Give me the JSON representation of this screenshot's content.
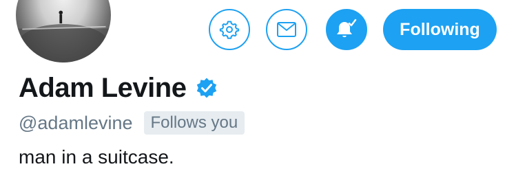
{
  "profile": {
    "display_name": "Adam Levine",
    "handle": "@adamlevine",
    "follows_you_label": "Follows you",
    "bio": "man in a suitcase.",
    "verified": true
  },
  "actions": {
    "settings_icon": "gear-icon",
    "message_icon": "envelope-icon",
    "notify_icon": "bell-check-icon",
    "follow_label": "Following"
  },
  "colors": {
    "accent": "#1da1f2",
    "text_primary": "#14171a",
    "text_secondary": "#657786",
    "badge_bg": "#e6ecf0"
  }
}
